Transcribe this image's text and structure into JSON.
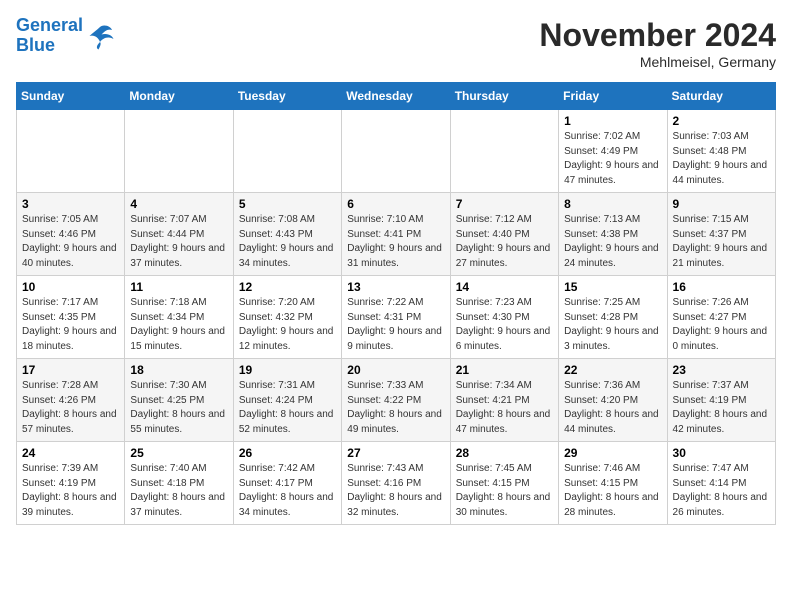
{
  "logo": {
    "line1": "General",
    "line2": "Blue"
  },
  "title": "November 2024",
  "subtitle": "Mehlmeisel, Germany",
  "days_header": [
    "Sunday",
    "Monday",
    "Tuesday",
    "Wednesday",
    "Thursday",
    "Friday",
    "Saturday"
  ],
  "weeks": [
    [
      {
        "day": "",
        "info": ""
      },
      {
        "day": "",
        "info": ""
      },
      {
        "day": "",
        "info": ""
      },
      {
        "day": "",
        "info": ""
      },
      {
        "day": "",
        "info": ""
      },
      {
        "day": "1",
        "info": "Sunrise: 7:02 AM\nSunset: 4:49 PM\nDaylight: 9 hours and 47 minutes."
      },
      {
        "day": "2",
        "info": "Sunrise: 7:03 AM\nSunset: 4:48 PM\nDaylight: 9 hours and 44 minutes."
      }
    ],
    [
      {
        "day": "3",
        "info": "Sunrise: 7:05 AM\nSunset: 4:46 PM\nDaylight: 9 hours and 40 minutes."
      },
      {
        "day": "4",
        "info": "Sunrise: 7:07 AM\nSunset: 4:44 PM\nDaylight: 9 hours and 37 minutes."
      },
      {
        "day": "5",
        "info": "Sunrise: 7:08 AM\nSunset: 4:43 PM\nDaylight: 9 hours and 34 minutes."
      },
      {
        "day": "6",
        "info": "Sunrise: 7:10 AM\nSunset: 4:41 PM\nDaylight: 9 hours and 31 minutes."
      },
      {
        "day": "7",
        "info": "Sunrise: 7:12 AM\nSunset: 4:40 PM\nDaylight: 9 hours and 27 minutes."
      },
      {
        "day": "8",
        "info": "Sunrise: 7:13 AM\nSunset: 4:38 PM\nDaylight: 9 hours and 24 minutes."
      },
      {
        "day": "9",
        "info": "Sunrise: 7:15 AM\nSunset: 4:37 PM\nDaylight: 9 hours and 21 minutes."
      }
    ],
    [
      {
        "day": "10",
        "info": "Sunrise: 7:17 AM\nSunset: 4:35 PM\nDaylight: 9 hours and 18 minutes."
      },
      {
        "day": "11",
        "info": "Sunrise: 7:18 AM\nSunset: 4:34 PM\nDaylight: 9 hours and 15 minutes."
      },
      {
        "day": "12",
        "info": "Sunrise: 7:20 AM\nSunset: 4:32 PM\nDaylight: 9 hours and 12 minutes."
      },
      {
        "day": "13",
        "info": "Sunrise: 7:22 AM\nSunset: 4:31 PM\nDaylight: 9 hours and 9 minutes."
      },
      {
        "day": "14",
        "info": "Sunrise: 7:23 AM\nSunset: 4:30 PM\nDaylight: 9 hours and 6 minutes."
      },
      {
        "day": "15",
        "info": "Sunrise: 7:25 AM\nSunset: 4:28 PM\nDaylight: 9 hours and 3 minutes."
      },
      {
        "day": "16",
        "info": "Sunrise: 7:26 AM\nSunset: 4:27 PM\nDaylight: 9 hours and 0 minutes."
      }
    ],
    [
      {
        "day": "17",
        "info": "Sunrise: 7:28 AM\nSunset: 4:26 PM\nDaylight: 8 hours and 57 minutes."
      },
      {
        "day": "18",
        "info": "Sunrise: 7:30 AM\nSunset: 4:25 PM\nDaylight: 8 hours and 55 minutes."
      },
      {
        "day": "19",
        "info": "Sunrise: 7:31 AM\nSunset: 4:24 PM\nDaylight: 8 hours and 52 minutes."
      },
      {
        "day": "20",
        "info": "Sunrise: 7:33 AM\nSunset: 4:22 PM\nDaylight: 8 hours and 49 minutes."
      },
      {
        "day": "21",
        "info": "Sunrise: 7:34 AM\nSunset: 4:21 PM\nDaylight: 8 hours and 47 minutes."
      },
      {
        "day": "22",
        "info": "Sunrise: 7:36 AM\nSunset: 4:20 PM\nDaylight: 8 hours and 44 minutes."
      },
      {
        "day": "23",
        "info": "Sunrise: 7:37 AM\nSunset: 4:19 PM\nDaylight: 8 hours and 42 minutes."
      }
    ],
    [
      {
        "day": "24",
        "info": "Sunrise: 7:39 AM\nSunset: 4:19 PM\nDaylight: 8 hours and 39 minutes."
      },
      {
        "day": "25",
        "info": "Sunrise: 7:40 AM\nSunset: 4:18 PM\nDaylight: 8 hours and 37 minutes."
      },
      {
        "day": "26",
        "info": "Sunrise: 7:42 AM\nSunset: 4:17 PM\nDaylight: 8 hours and 34 minutes."
      },
      {
        "day": "27",
        "info": "Sunrise: 7:43 AM\nSunset: 4:16 PM\nDaylight: 8 hours and 32 minutes."
      },
      {
        "day": "28",
        "info": "Sunrise: 7:45 AM\nSunset: 4:15 PM\nDaylight: 8 hours and 30 minutes."
      },
      {
        "day": "29",
        "info": "Sunrise: 7:46 AM\nSunset: 4:15 PM\nDaylight: 8 hours and 28 minutes."
      },
      {
        "day": "30",
        "info": "Sunrise: 7:47 AM\nSunset: 4:14 PM\nDaylight: 8 hours and 26 minutes."
      }
    ]
  ]
}
